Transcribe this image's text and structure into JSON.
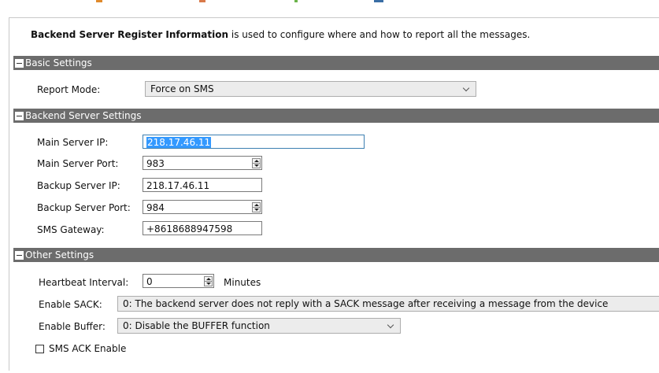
{
  "intro": {
    "title": "Backend Server Register Information",
    "text": " is used to configure where and how to report all the messages."
  },
  "sections": {
    "basic": "Basic Settings",
    "backend": "Backend Server Settings",
    "other": "Other Settings"
  },
  "basic": {
    "report_mode_label": "Report Mode:",
    "report_mode_value": "Force on SMS"
  },
  "backend": {
    "main_ip_label": "Main Server IP:",
    "main_ip_value": "218.17.46.11",
    "main_port_label": "Main Server Port:",
    "main_port_value": "983",
    "backup_ip_label": "Backup Server IP:",
    "backup_ip_value": "218.17.46.11",
    "backup_port_label": "Backup Server Port:",
    "backup_port_value": "984",
    "sms_gateway_label": "SMS Gateway:",
    "sms_gateway_value": "+8618688947598"
  },
  "other": {
    "heartbeat_label": "Heartbeat Interval:",
    "heartbeat_value": "0",
    "heartbeat_unit": "Minutes",
    "sack_label": "Enable SACK:",
    "sack_value": "0: The backend server does not reply with a SACK message after receiving a message from the device",
    "buffer_label": "Enable Buffer:",
    "buffer_value": "0: Disable the BUFFER function",
    "sms_ack_label": "SMS ACK Enable"
  },
  "colors": {
    "section_header": "#6c6c6c",
    "selection": "#3399ff"
  }
}
